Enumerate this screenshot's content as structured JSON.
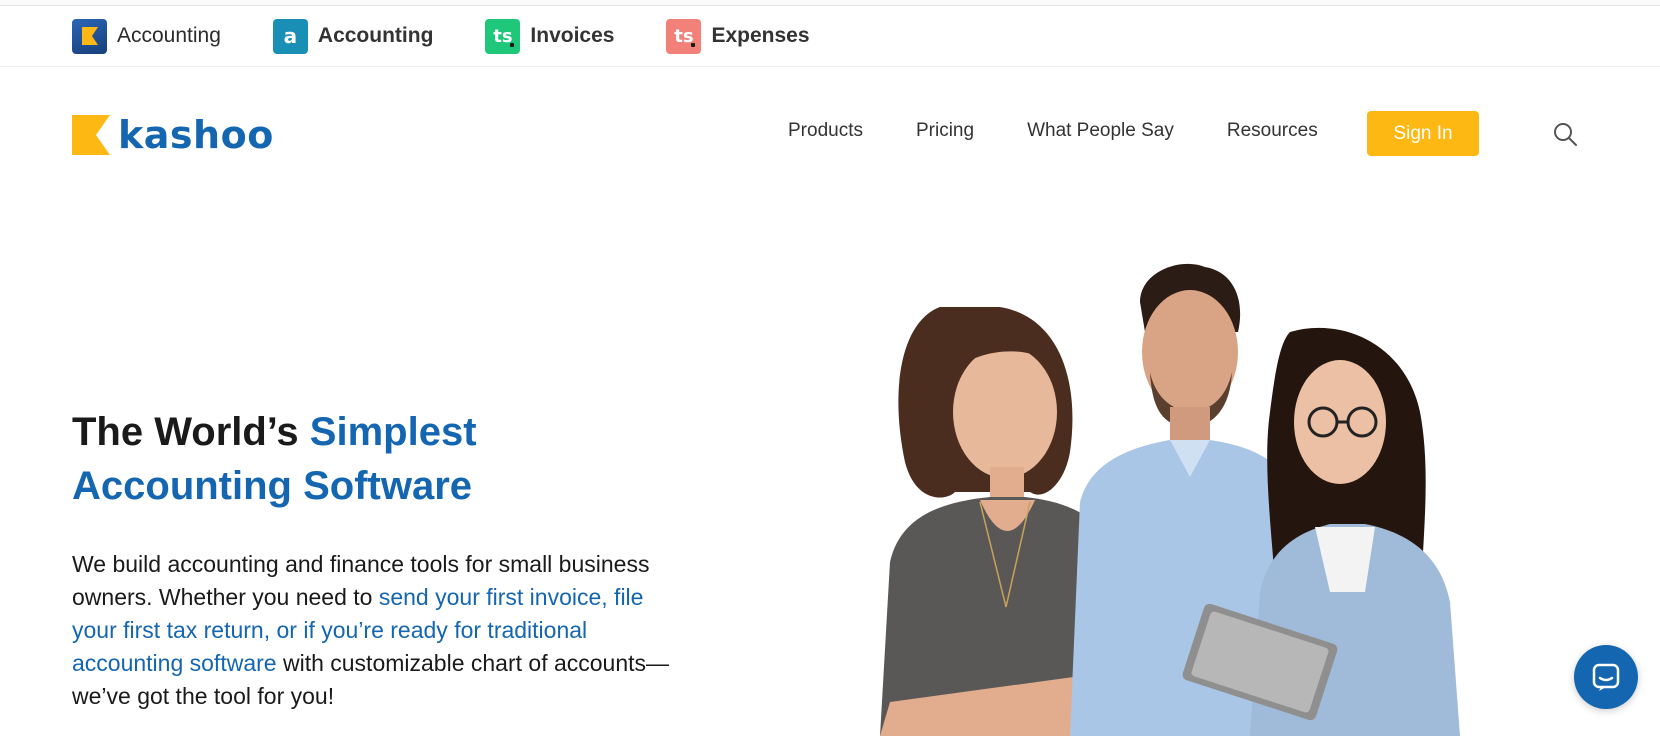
{
  "products": [
    {
      "name": "Accounting",
      "icon": "kashoo-k-icon",
      "color": "#1f56a0",
      "bold": false
    },
    {
      "name": "Accounting",
      "icon": "a-letter-icon",
      "glyph": "a",
      "color": "#1a8fb5",
      "bold": true
    },
    {
      "name": "Invoices",
      "icon": "ts-letters-icon",
      "glyph": "ts",
      "color": "#1ec77a",
      "bold": true
    },
    {
      "name": "Expenses",
      "icon": "ts-letters-icon",
      "glyph": "ts",
      "color": "#f2817a",
      "bold": true
    }
  ],
  "brand": {
    "wordmark": "kashoo",
    "color": "#1466b0",
    "mark_color": "#fdb813"
  },
  "nav": {
    "links": [
      "Products",
      "Pricing",
      "What People Say",
      "Resources"
    ],
    "signin_label": "Sign In",
    "signin_color": "#fdb813"
  },
  "hero": {
    "title_part1": "The World’s ",
    "title_accent1": "Simplest",
    "title_accent2": "Accounting Software",
    "body_part1": "We build accounting and finance tools for small business owners. Whether you need to ",
    "body_link": "send your first invoice, file your first tax return, or if you’re ready for traditional accounting software",
    "body_part2": " with customizable chart of accounts—we’ve got the tool for you!",
    "accent_color": "#1466b0"
  },
  "chat": {
    "icon": "chat-bubble-icon",
    "color": "#1466b0"
  }
}
